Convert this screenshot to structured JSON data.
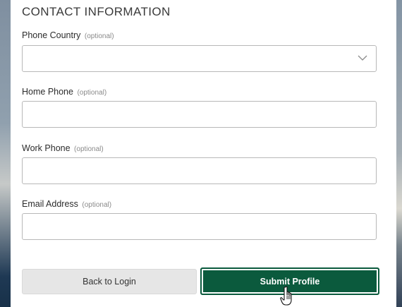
{
  "section": {
    "title": "CONTACT INFORMATION"
  },
  "fields": {
    "phone_country": {
      "label": "Phone Country",
      "optional": "(optional)",
      "value": ""
    },
    "home_phone": {
      "label": "Home Phone",
      "optional": "(optional)",
      "value": ""
    },
    "work_phone": {
      "label": "Work Phone",
      "optional": "(optional)",
      "value": ""
    },
    "email": {
      "label": "Email Address",
      "optional": "(optional)",
      "value": ""
    }
  },
  "buttons": {
    "back_label": "Back to Login",
    "submit_label": "Submit Profile"
  },
  "colors": {
    "primary": "#0b5a3d",
    "secondary_button": "#e6e6e6"
  },
  "icons": {
    "dropdown": "chevron-down-icon",
    "cursor": "hand-pointer-icon"
  }
}
